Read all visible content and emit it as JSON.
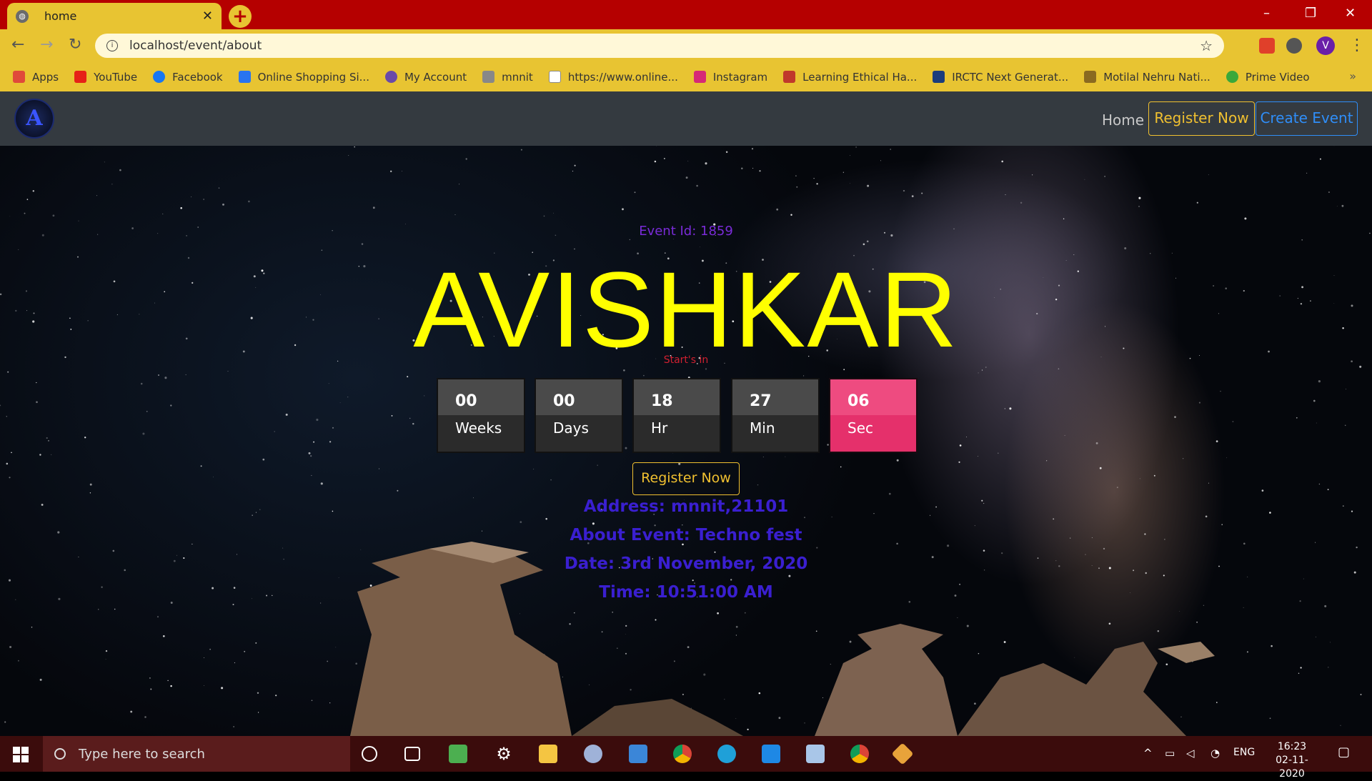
{
  "browser": {
    "tab_title": "home",
    "tab_close": "✕",
    "new_tab": "+",
    "url": "localhost/event/about",
    "profile_initial": "V",
    "window_controls": {
      "minimize": "–",
      "restore": "❐",
      "close": "✕"
    },
    "bookmarks": [
      {
        "label": "Apps",
        "color": "#e04a3a"
      },
      {
        "label": "YouTube",
        "color": "#e62117"
      },
      {
        "label": "Facebook",
        "color": "#1877f2"
      },
      {
        "label": "Online Shopping Si...",
        "color": "#2874f0"
      },
      {
        "label": "My Account",
        "color": "#6a4aa8"
      },
      {
        "label": "mnnit",
        "color": "#888888"
      },
      {
        "label": "https://www.online...",
        "color": "#ffffff"
      },
      {
        "label": "Instagram",
        "color": "#d62976"
      },
      {
        "label": "Learning Ethical Ha...",
        "color": "#c0392b"
      },
      {
        "label": "IRCTC Next Generat...",
        "color": "#1a3d7c"
      },
      {
        "label": "Motilal Nehru Nati...",
        "color": "#8a6a20"
      },
      {
        "label": "Prime Video",
        "color": "#3aa83a"
      }
    ],
    "bookmarks_more": "»"
  },
  "navbar": {
    "logo_letter": "A",
    "home": "Home",
    "register": "Register Now",
    "create": "Create Event"
  },
  "event": {
    "id_line": "Event Id: 1859",
    "name": "AVISHKAR",
    "starts_in": "Start's in",
    "countdown": [
      {
        "value": "00",
        "label": "Weeks"
      },
      {
        "value": "00",
        "label": "Days"
      },
      {
        "value": "18",
        "label": "Hr"
      },
      {
        "value": "27",
        "label": "Min"
      },
      {
        "value": "06",
        "label": "Sec"
      }
    ],
    "register_button": "Register Now",
    "address": "Address: mnnit,21101",
    "about": "About Event: Techno fest",
    "date": "Date: 3rd November, 2020",
    "time": "Time: 10:51:00 AM"
  },
  "taskbar": {
    "search_placeholder": "Type here to search",
    "language": "ENG",
    "time": "16:23",
    "date": "02-11-2020"
  }
}
